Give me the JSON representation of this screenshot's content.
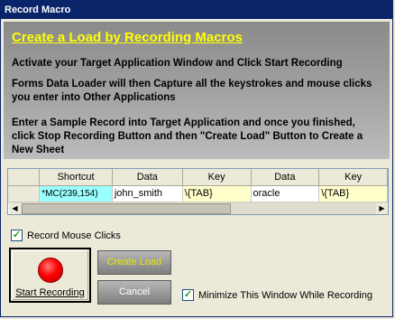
{
  "window": {
    "title": "Record Macro"
  },
  "header": {
    "title": "Create a Load by Recording Macros",
    "line1": "Activate your Target Application Window and Click Start Recording",
    "line2a": "Forms Data Loader will then Capture all the keystrokes and mouse clicks",
    "line2b": "you enter into Other Applications",
    "line3a": "Enter a Sample Record into Target Application and once you finished,",
    "line3b": "click Stop Recording Button and then \"Create Load\" Button to Create a",
    "line3c": "New Sheet"
  },
  "grid": {
    "columns": [
      "",
      "Shortcut",
      "Data",
      "Key",
      "Data",
      "Key"
    ],
    "row": [
      "",
      "*MC(239,154)",
      "john_smith",
      "\\{TAB}",
      "oracle",
      "\\{TAB}"
    ]
  },
  "options": {
    "record_mouse": {
      "label": "Record Mouse Clicks",
      "checked": true
    },
    "minimize": {
      "label": "Minimize This Window While Recording",
      "checked": true
    }
  },
  "buttons": {
    "start": "Start Recording",
    "create": "Create Load",
    "cancel": "Cancel"
  },
  "colors": {
    "title_text": "#ffff00",
    "shortcut_cell": "#99ffff",
    "key_cell": "#ffffcc",
    "titlebar": "#0a246a",
    "record": "#ff0000"
  }
}
